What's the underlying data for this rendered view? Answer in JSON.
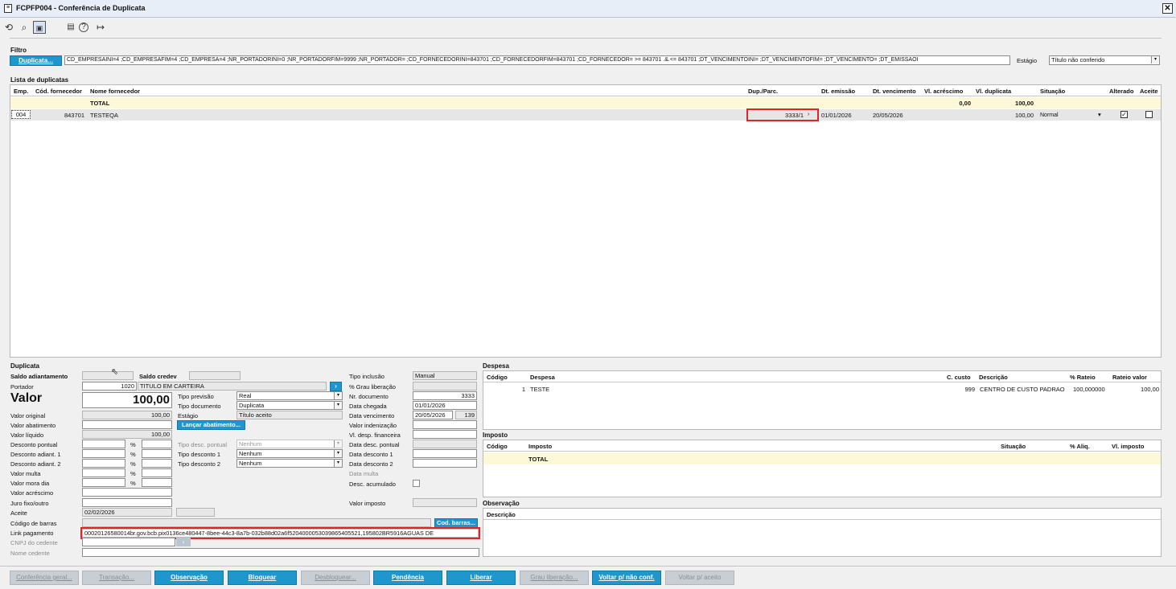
{
  "window": {
    "title": "FCPFP004 - Conferência de Duplicata",
    "close": "✕"
  },
  "toolbar": {
    "icons": [
      "refresh-icon",
      "search-icon",
      "save-icon",
      "calendar-icon",
      "help-icon",
      "exit-icon"
    ],
    "glyphs": [
      "⟲",
      "⌕",
      "💾",
      "🗓",
      "?",
      "↦"
    ]
  },
  "filter": {
    "section": "Filtro",
    "button": "Duplicata...",
    "query": "CD_EMPRESAINI=4 ;CD_EMPRESAFIM=4 ;CD_EMPRESA=4 ;NR_PORTADORINI=0 ;NR_PORTADORFIM=9999 ;NR_PORTADOR= ;CD_FORNECEDORINI=843701 ;CD_FORNECEDORFIM=843701 ;CD_FORNECEDOR= >= 843701 .&.<= 843701 ;DT_VENCIMENTOINI= ;DT_VENCIMENTOFIM= ;DT_VENCIMENTO= ;DT_EMISSAOI",
    "stage_label": "Estágio",
    "stage_value": "Título não conferido"
  },
  "list": {
    "section": "Lista de duplicatas",
    "columns": [
      "Emp.",
      "Cód. fornecedor",
      "Nome fornecedor",
      "Dup./Parc.",
      "Dt. emissão",
      "Dt. vencimento",
      "Vl. acréscimo",
      "Vl. duplicata",
      "Situação",
      "Alterado",
      "Aceite"
    ],
    "total": {
      "label": "TOTAL",
      "acrescimo": "0,00",
      "duplicata": "100,00"
    },
    "rows": [
      {
        "emp": "004",
        "cod": "843701",
        "nome": "TESTEQA",
        "dup": "3333/1",
        "emissao": "01/01/2026",
        "vencimento": "20/05/2026",
        "vl_duplicata": "100,00",
        "situacao": "Normal",
        "alterado": true,
        "aceite": false
      }
    ]
  },
  "duplicata": {
    "section": "Duplicata",
    "saldo_adiant": "Saldo adiantamento",
    "saldo_credev": "Saldo credev",
    "portador_label": "Portador",
    "portador_num": "1020",
    "portador_name": "TITULO EM CARTEIRA",
    "valor_label": "Valor",
    "valor": "100,00",
    "valor_original_label": "Valor original",
    "valor_original": "100,00",
    "valor_abatimento_label": "Valor abatimento",
    "valor_liquido_label": "Valor líquido",
    "valor_liquido": "100,00",
    "desconto_pontual_label": "Desconto pontual",
    "desconto_adiant1_label": "Desconto adiant. 1",
    "desconto_adiant2_label": "Desconto adiant. 2",
    "valor_multa_label": "Valor multa",
    "valor_mora_label": "Valor mora dia",
    "valor_acrescimo_label": "Valor acréscimo",
    "juro_label": "Juro fixo/outro",
    "aceite_label": "Aceite",
    "aceite_date": "02/02/2026",
    "codigo_barras_label": "Código de barras",
    "link_label": "Link pagamento",
    "link_value": "00020126580014br.gov.bcb.pix0136ce480447-8bee-44c3-8a7b-032b88d02a6f5204000053039865405521,195802BR5916AGUAS DE",
    "cnpj_label": "CNPJ do cedente",
    "nome_cedente_label": "Nome cedente",
    "pct": "%",
    "tipo_previsao_label": "Tipo previsão",
    "tipo_previsao": "Real",
    "tipo_documento_label": "Tipo documento",
    "tipo_documento": "Duplicata",
    "estagio_label": "Estágio",
    "estagio": "Título aceito",
    "lancar_btn": "Lançar abatimento...",
    "tipo_desc_pontual_label": "Tipo desc. pontual",
    "tipo_desc_pontual": "Nenhum",
    "tipo_desconto1_label": "Tipo desconto 1",
    "tipo_desconto1": "Nenhum",
    "tipo_desconto2_label": "Tipo desconto 2",
    "tipo_desconto2": "Nenhum",
    "tipo_inclusao_label": "Tipo inclusão",
    "tipo_inclusao": "Manual",
    "grau_lib_label": "% Grau liberação",
    "nr_doc_label": "Nr. documento",
    "nr_doc": "3333",
    "data_chegada_label": "Data chegada",
    "data_chegada": "01/01/2026",
    "data_venc_label": "Data vencimento",
    "data_venc": "20/05/2026",
    "data_venc_days": "139",
    "valor_indeniz_label": "Valor indenização",
    "vl_desp_fin_label": "Vl. desp. financeira",
    "data_desc_pontual_label": "Data desc. pontual",
    "data_desc1_label": "Data desconto 1",
    "data_desc2_label": "Data desconto 2",
    "data_multa_label": "Data multa",
    "desc_acum_label": "Desc. acumulado",
    "valor_imposto_label": "Valor imposto",
    "cod_barras_btn": "Cod. barras..."
  },
  "despesa": {
    "section": "Despesa",
    "columns": [
      "Código",
      "Despesa",
      "C. custo",
      "Descrição",
      "% Rateio",
      "Rateio valor"
    ],
    "rows": [
      {
        "codigo": "1",
        "despesa": "TESTE",
        "ccusto": "999",
        "descricao": "CENTRO DE CUSTO PADRAO",
        "rateio": "100,000000",
        "valor": "100,00"
      }
    ]
  },
  "imposto": {
    "section": "Imposto",
    "columns": [
      "Código",
      "Imposto",
      "Situação",
      "% Aliq.",
      "Vl. imposto"
    ],
    "total": "TOTAL"
  },
  "observacao": {
    "section": "Observação",
    "column": "Descrição"
  },
  "buttons": [
    {
      "label": "Conferência geral...",
      "enabled": false
    },
    {
      "label": "Transação...",
      "enabled": false
    },
    {
      "label": "Observação",
      "enabled": true
    },
    {
      "label": "Bloquear",
      "enabled": true
    },
    {
      "label": "Desbloquear...",
      "enabled": false
    },
    {
      "label": "Pendência",
      "enabled": true
    },
    {
      "label": "Liberar",
      "enabled": true
    },
    {
      "label": "Grau liberação...",
      "enabled": false
    },
    {
      "label": "Voltar p/ não conf.",
      "enabled": true
    },
    {
      "label": "Voltar p/ aceito",
      "enabled": false
    }
  ]
}
